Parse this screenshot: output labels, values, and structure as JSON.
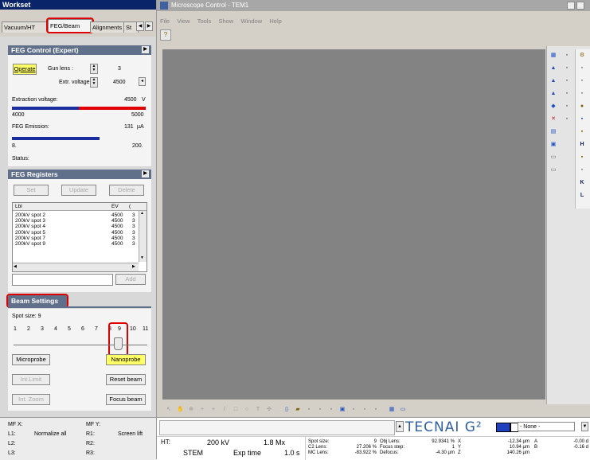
{
  "workset": {
    "title": "Workset",
    "tabs": [
      "Vacuum/HT",
      "FEG/Beam",
      "Alignments",
      "St"
    ],
    "feg_control": {
      "title": "FEG Control (Expert)",
      "operate_label": "Operate",
      "gun_lens_label": "Gun lens :",
      "gun_lens_value": "3",
      "extr_voltage_label": "Extr. voltage:",
      "extr_voltage_value": "4500",
      "extraction_label": "Extraction voltage:",
      "extraction_value": "4500",
      "extraction_unit": "V",
      "extraction_min": "4000",
      "extraction_max": "5000",
      "extraction_fraction": 0.5,
      "emission_label": "FEG Emission:",
      "emission_value": "131",
      "emission_unit": "µA",
      "emission_min": "8.",
      "emission_max": "200.",
      "status_label": "Status:"
    },
    "feg_registers": {
      "title": "FEG Registers",
      "set_label": "Set",
      "update_label": "Update",
      "delete_label": "Delete",
      "columns": [
        "Lbl",
        "EV",
        "("
      ],
      "rows": [
        [
          "200kV spot 2",
          "4500",
          "3"
        ],
        [
          "200kV spot 3",
          "4500",
          "3"
        ],
        [
          "200kV spot 4",
          "4500",
          "3"
        ],
        [
          "200kV spot 5",
          "4500",
          "3"
        ],
        [
          "200kV spot 7",
          "4500",
          "3"
        ],
        [
          "200kV spot 9",
          "4500",
          "3"
        ]
      ],
      "add_label": "Add"
    },
    "beam_settings": {
      "title": "Beam Settings",
      "spot_size_label": "Spot size: 9",
      "ticks": [
        "1",
        "2",
        "3",
        "4",
        "5",
        "6",
        "7",
        "8",
        "9",
        "10",
        "11"
      ],
      "microprobe_label": "Microprobe",
      "nanoprobe_label": "Nanoprobe",
      "int_limit_label": "Int.Limit",
      "reset_beam_label": "Reset beam",
      "int_zoom_label": "Int. Zoom",
      "focus_beam_label": "Focus beam"
    },
    "status_bar": {
      "mfx": "MF X:",
      "mfy": "MF Y:",
      "l1": "L1:",
      "normalize": "Normalize all",
      "r1": "R1:",
      "screen": "Screen lift",
      "l2": "L2:",
      "r2": "R2:",
      "l3": "L3:",
      "r3": "R3:"
    }
  },
  "main": {
    "title": "Microscope Control - TEM1",
    "menu": [
      "File",
      "View",
      "Tools",
      "Show",
      "Window",
      "Help"
    ],
    "brand": "TECNAI G²",
    "none_label": "- None -",
    "ht_label": "HT:",
    "ht_value": "200 kV",
    "mag_value": "1.8 Mx",
    "mode": "STEM",
    "exp_time_label": "Exp time",
    "exp_time_value": "1.0 s",
    "lens_labels": [
      "Spot size:",
      "C2 Lens:",
      "MC Lens:"
    ],
    "lens_values": [
      "9",
      "27.206 %",
      "-83.922 %"
    ],
    "focus_labels": [
      "Obj Lens:",
      "Focus step:",
      "Defocus:"
    ],
    "focus_values": [
      "92.9341 %",
      "1",
      "-4.30 µm"
    ],
    "stage_labels": [
      "X",
      "Y",
      "Z"
    ],
    "stage_values": [
      "-12.34 µm",
      "10.94 µm",
      "140.26 µm"
    ],
    "angle_labels": [
      "A",
      "B"
    ],
    "angle_values": [
      "-0.00 d",
      "-0.16 d"
    ]
  }
}
